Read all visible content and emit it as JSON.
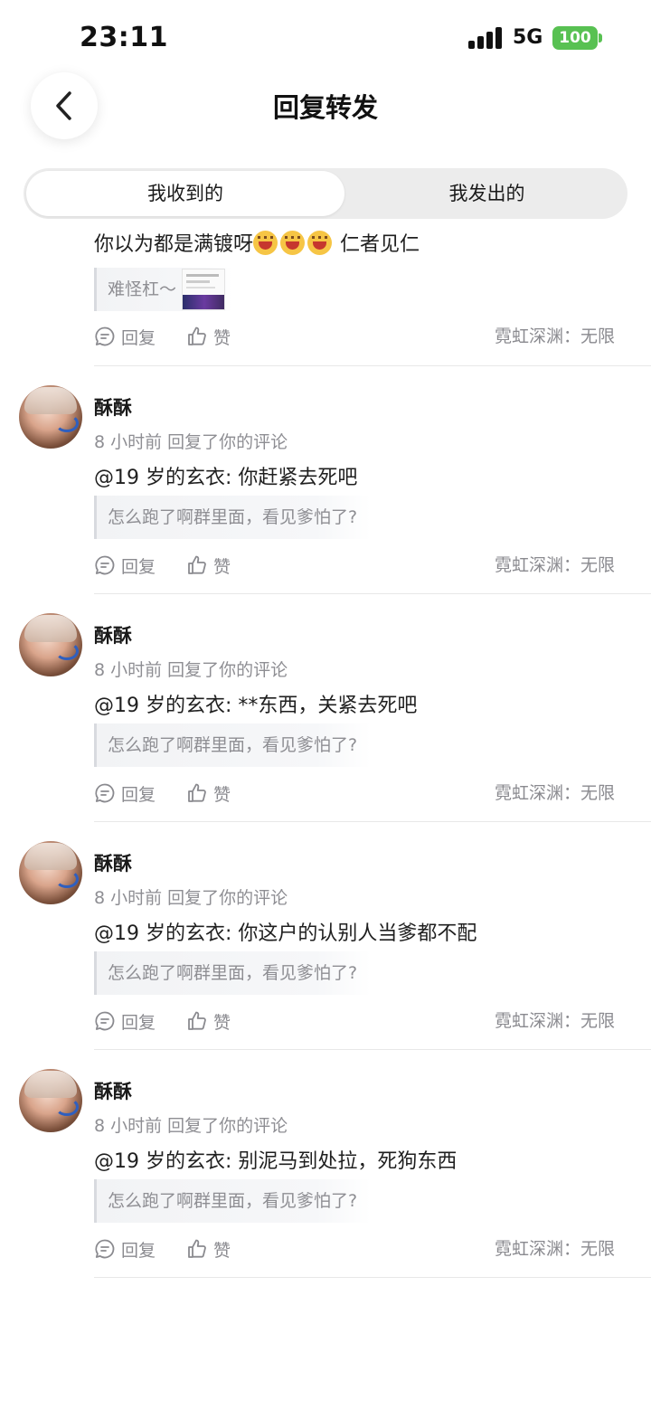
{
  "status_bar": {
    "time": "23:11",
    "network": "5G",
    "battery": "100"
  },
  "header": {
    "title": "回复转发"
  },
  "tabs": [
    {
      "label": "我收到的",
      "active": true
    },
    {
      "label": "我发出的",
      "active": false
    }
  ],
  "first_item": {
    "text_start": "你以为都是满镀呀",
    "text_end": "仁者见仁",
    "quote": "难怪杠～",
    "reply_label": "回复",
    "like_label": "赞",
    "location": "霓虹深渊：无限"
  },
  "items": [
    {
      "username": "酥酥",
      "meta": "8 小时前 回复了你的评论",
      "text": "@19 岁的玄衣: 你赶紧去死吧",
      "quote": "怎么跑了啊群里面，看见爹怕了?",
      "reply_label": "回复",
      "like_label": "赞",
      "location": "霓虹深渊：无限"
    },
    {
      "username": "酥酥",
      "meta": "8 小时前 回复了你的评论",
      "text": "@19 岁的玄衣: **东西，关紧去死吧",
      "quote": "怎么跑了啊群里面，看见爹怕了?",
      "reply_label": "回复",
      "like_label": "赞",
      "location": "霓虹深渊：无限"
    },
    {
      "username": "酥酥",
      "meta": "8 小时前 回复了你的评论",
      "text": "@19 岁的玄衣: 你这户的认别人当爹都不配",
      "quote": "怎么跑了啊群里面，看见爹怕了?",
      "reply_label": "回复",
      "like_label": "赞",
      "location": "霓虹深渊：无限"
    },
    {
      "username": "酥酥",
      "meta": "8 小时前 回复了你的评论",
      "text": "@19 岁的玄衣: 别泥马到处拉，死狗东西",
      "quote": "怎么跑了啊群里面，看见爹怕了?",
      "reply_label": "回复",
      "like_label": "赞",
      "location": "霓虹深渊：无限"
    }
  ]
}
